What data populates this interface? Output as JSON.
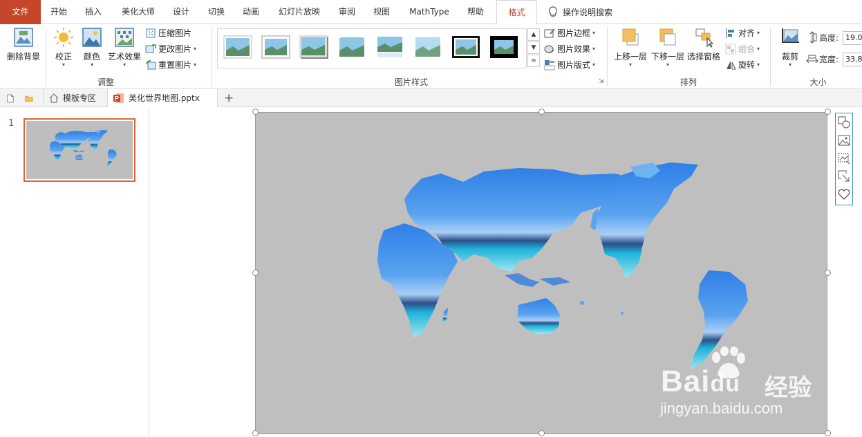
{
  "tabs": [
    "文件",
    "开始",
    "插入",
    "美化大师",
    "设计",
    "切换",
    "动画",
    "幻灯片放映",
    "审阅",
    "视图",
    "MathType",
    "帮助",
    "格式"
  ],
  "active_tab": "格式",
  "tell_me": "操作说明搜索",
  "ribbon": {
    "adjust": {
      "remove_bg": "删除背景",
      "correct": "校正",
      "color": "颜色",
      "artistic": "艺术效果",
      "compress": "压缩图片",
      "change": "更改图片",
      "reset": "重置图片",
      "label": "调整"
    },
    "styles": {
      "border": "图片边框",
      "effects": "图片效果",
      "layout": "图片版式",
      "label": "图片样式"
    },
    "arrange": {
      "bring_forward": "上移一层",
      "send_backward": "下移一层",
      "selection_pane": "选择窗格",
      "align": "对齐",
      "group": "组合",
      "rotate": "旋转",
      "label": "排列"
    },
    "size": {
      "crop": "裁剪",
      "height_label": "高度:",
      "height_value": "19.0",
      "width_label": "宽度:",
      "width_value": "33.8",
      "label": "大小"
    }
  },
  "doc_tabs": {
    "template": "模板专区",
    "file": "美化世界地图.pptx",
    "add": "+"
  },
  "slides": {
    "current_number": "1"
  },
  "watermark": {
    "brand_latin": "Bai",
    "brand_du": "du",
    "brand_cn": "经验",
    "url": "jingyan.baidu.com"
  },
  "colors": {
    "file_tab": "#c5462a",
    "accent": "#b7472a",
    "slide_bg": "#bfbfbf",
    "selection": "#d9653f"
  }
}
